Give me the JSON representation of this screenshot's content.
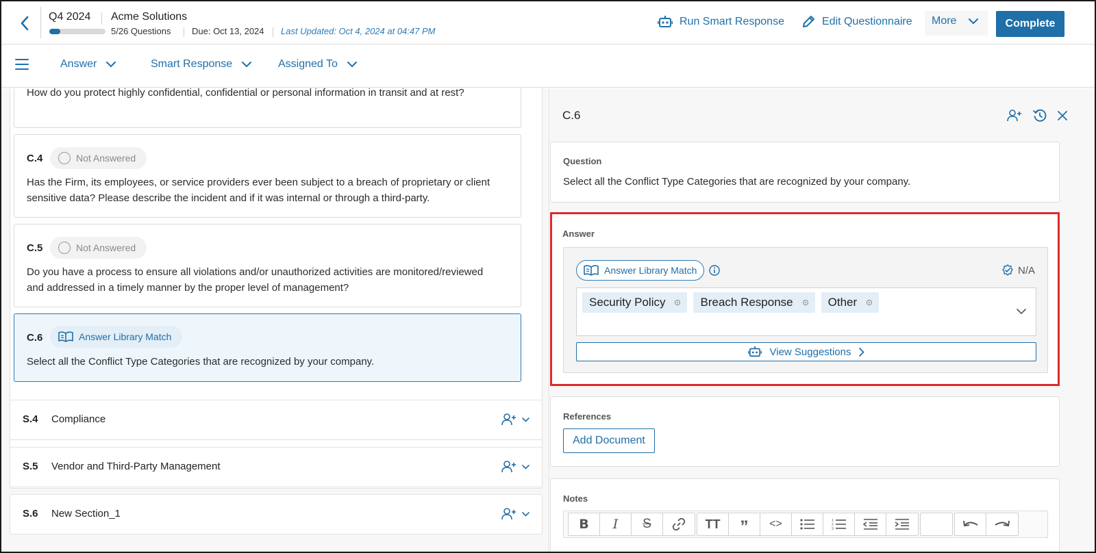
{
  "header": {
    "period": "Q4 2024",
    "company": "Acme Solutions",
    "progress": {
      "answered": 5,
      "total": 26,
      "fraction": 0.192,
      "label": "5/26 Questions"
    },
    "due": "Due: Oct 13, 2024",
    "last_updated": "Last Updated: Oct 4, 2024 at 04:47 PM",
    "actions": {
      "run_smart_response": "Run Smart Response",
      "edit_questionnaire": "Edit Questionnaire",
      "more": "More",
      "complete": "Complete"
    }
  },
  "filters": {
    "answer": "Answer",
    "smart_response": "Smart Response",
    "assigned_to": "Assigned To"
  },
  "questions": [
    {
      "id": "",
      "status": "",
      "text": "How do you protect highly confidential, confidential or personal information in transit and at rest?"
    },
    {
      "id": "C.4",
      "status": "Not Answered",
      "text": "Has the Firm, its employees, or service providers ever been subject to a breach of proprietary or client sensitive data? Please describe the incident and if it was internal or through a third-party."
    },
    {
      "id": "C.5",
      "status": "Not Answered",
      "text": "Do you have a process to ensure all violations and/or unauthorized activities are monitored/reviewed and addressed in a timely manner by the proper level of management?"
    },
    {
      "id": "C.6",
      "status": "Answer Library Match",
      "text": "Select all the Conflict Type Categories that are recognized by your company."
    }
  ],
  "sections": [
    {
      "id": "S.4",
      "name": "Compliance"
    },
    {
      "id": "S.5",
      "name": "Vendor and Third-Party Management"
    },
    {
      "id": "S.6",
      "name": "New Section_1"
    }
  ],
  "detail": {
    "title": "C.6",
    "question_label": "Question",
    "question_text": "Select all the Conflict Type Categories that are recognized by your company.",
    "answer_label": "Answer",
    "answer_source": "Answer Library Match",
    "na_label": "N/A",
    "selected_options": [
      "Security Policy",
      "Breach Response",
      "Other"
    ],
    "view_suggestions": "View Suggestions",
    "references_label": "References",
    "add_document": "Add Document",
    "notes_label": "Notes"
  },
  "colors": {
    "accent": "#1f6fa8",
    "highlight_border": "#dd2b2b",
    "selected_card_bg": "#eef6fb",
    "chip_bg": "#e3eef7"
  }
}
